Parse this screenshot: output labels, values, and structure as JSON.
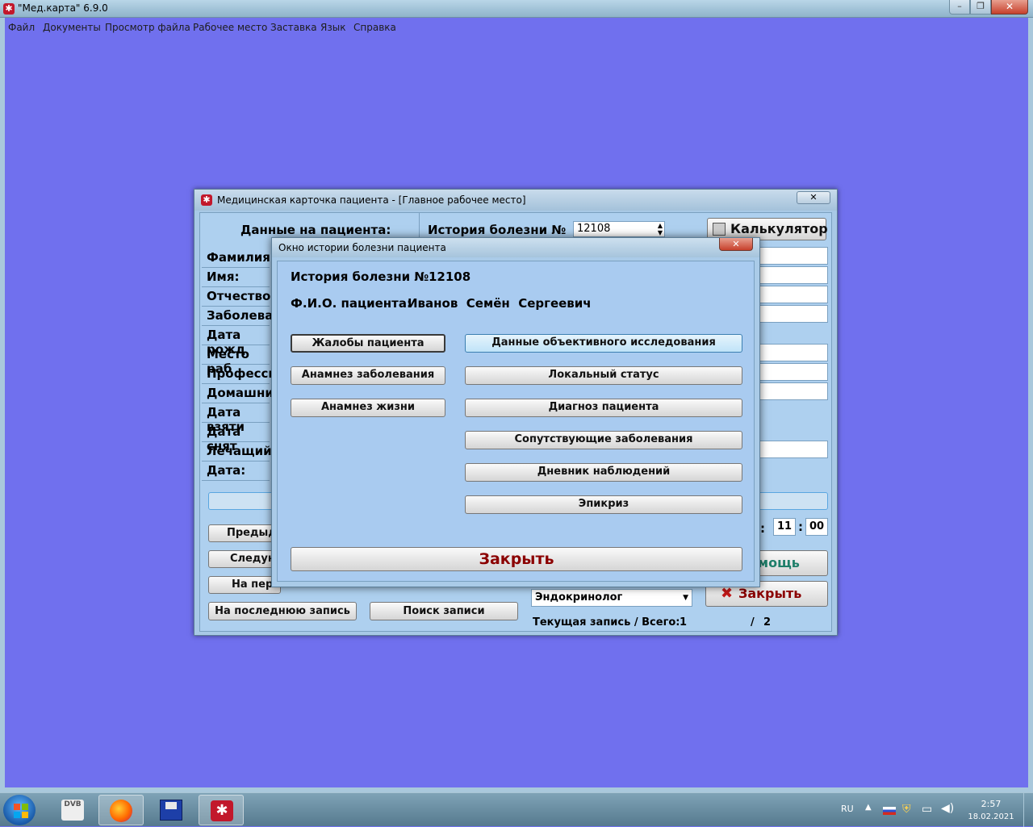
{
  "app": {
    "title": "\"Мед.карта\" 6.9.0",
    "menu": [
      "Файл",
      "Документы",
      "Просмотр файла",
      "Рабочее место",
      "Заставка",
      "Язык",
      "Справка"
    ]
  },
  "card": {
    "title": "Медицинская карточка пациента - [Главное рабочее место]",
    "header_left": "Данные на пациента:",
    "history_label": "История болезни №",
    "history_number": "12108",
    "calculator_label": "Калькулятор",
    "fields": [
      "Фамилия:",
      "Имя:",
      "Отчество:",
      "Заболева",
      "Дата рожд",
      "Место раб",
      "Професси",
      "Домашни",
      "Дата взяти",
      "Дата снят",
      "Лечащий",
      "Дата:"
    ],
    "nav_buttons": [
      "Предыду",
      "Следую",
      "На пер",
      "На последнюю запись"
    ],
    "search_button": "Поиск записи",
    "help_button": "мощь",
    "close_button": "Закрыть",
    "doctor_select": "Эндокринолог",
    "time_hour": "11",
    "time_min": "00",
    "time_colon": ":",
    "record_label": "Текущая запись / Всего:",
    "record_current": "1",
    "record_sep": "/",
    "record_total": "2"
  },
  "modal": {
    "title": "Окно истории болезни пациента",
    "history_label": "История болезни №",
    "history_number": "12108",
    "fio_label": "Ф.И.О. пациента:",
    "fio_value": "Иванов  Семён  Сергеевич",
    "left_buttons": [
      "Жалобы пациента",
      "Анамнез заболевания",
      "Анамнез жизни"
    ],
    "right_buttons": [
      "Данные объективного исследования",
      "Локальный статус",
      "Диагноз пациента",
      "Сопутствующие заболевания",
      "Дневник наблюдений",
      "Эпикриз"
    ],
    "close_button": "Закрыть"
  },
  "taskbar": {
    "dvb_label": "DVB",
    "language": "RU",
    "time": "2:57",
    "date": "18.02.2021"
  },
  "colors": {
    "desktop": "#7070ee",
    "panel": "#aacbe8",
    "close_text": "#8b0000",
    "help_text": "#1f7f6a"
  }
}
